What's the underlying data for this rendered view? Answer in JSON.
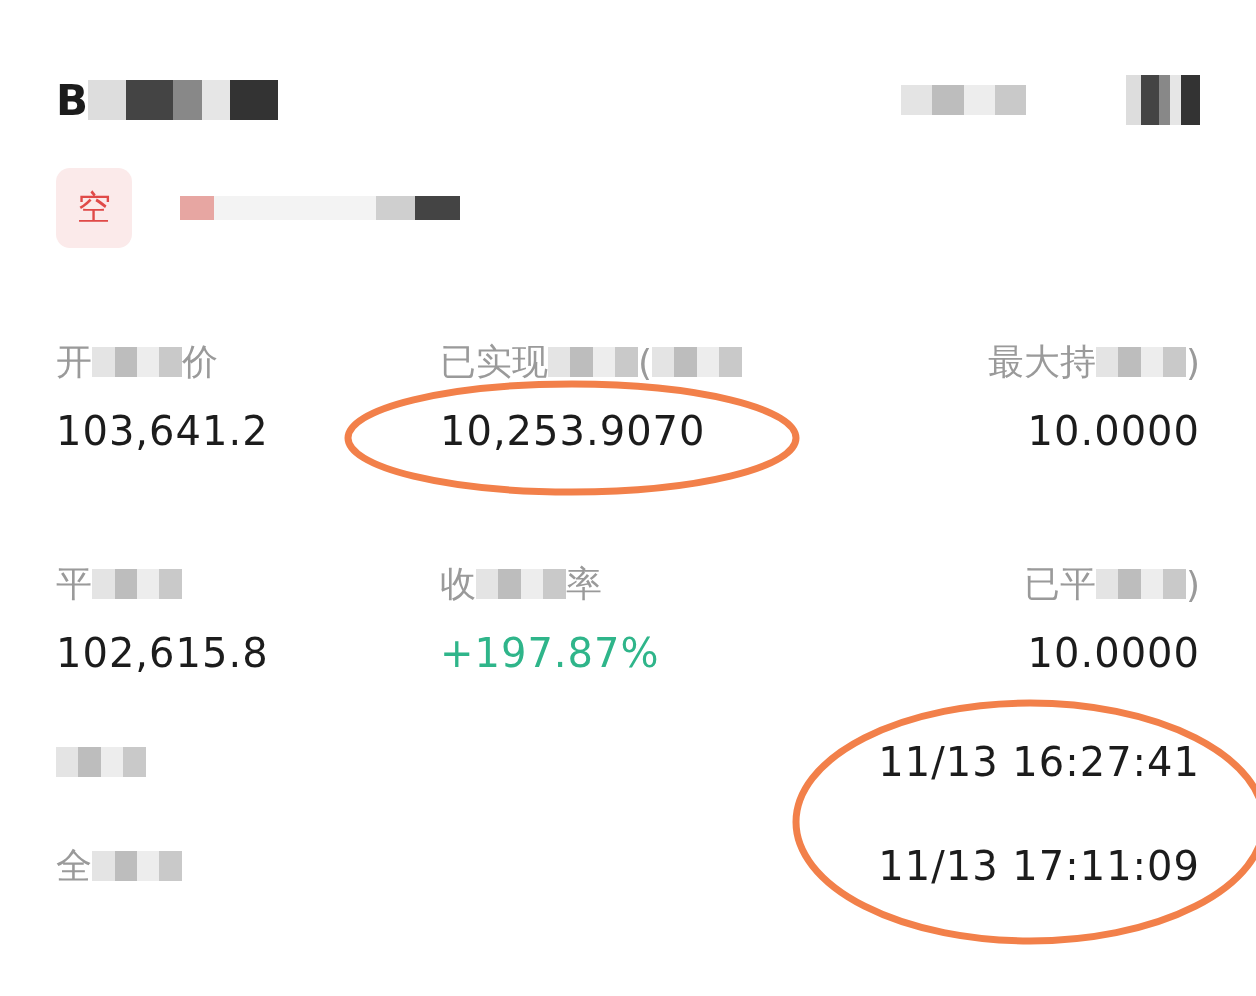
{
  "header": {
    "symbol": [
      {
        "kind": "text",
        "text": "B"
      },
      {
        "kind": "blur"
      }
    ],
    "right": [
      {
        "kind": "blur"
      }
    ]
  },
  "position": {
    "side": "空",
    "info": [
      {
        "kind": "blur"
      }
    ]
  },
  "stats": [
    {
      "label": [
        {
          "kind": "text",
          "text": "开"
        },
        {
          "kind": "blur"
        },
        {
          "kind": "text",
          "text": "价"
        }
      ],
      "value": "103,641.2",
      "color": "#1c1c1c"
    },
    {
      "label": [
        {
          "kind": "text",
          "text": "已实现"
        },
        {
          "kind": "blur"
        },
        {
          "kind": "text",
          "text": "("
        },
        {
          "kind": "blur"
        }
      ],
      "value": "10,253.9070",
      "color": "#1c1c1c"
    },
    {
      "label": [
        {
          "kind": "text",
          "text": "最大持"
        },
        {
          "kind": "blur"
        },
        {
          "kind": "text",
          "text": ")"
        }
      ],
      "value": "10.0000",
      "color": "#1c1c1c"
    },
    {
      "label": [
        {
          "kind": "text",
          "text": "平"
        },
        {
          "kind": "blur"
        }
      ],
      "value": "102,615.8",
      "color": "#1c1c1c"
    },
    {
      "label": [
        {
          "kind": "text",
          "text": "收"
        },
        {
          "kind": "blur"
        },
        {
          "kind": "text",
          "text": "率"
        }
      ],
      "value": "+197.87%",
      "color": "#2fb58a"
    },
    {
      "label": [
        {
          "kind": "text",
          "text": "已平"
        },
        {
          "kind": "blur"
        },
        {
          "kind": "text",
          "text": ")"
        }
      ],
      "value": "10.0000",
      "color": "#1c1c1c"
    }
  ],
  "times": [
    {
      "label": [
        {
          "kind": "blur"
        }
      ],
      "value": "11/13 16:27:41"
    },
    {
      "label": [
        {
          "kind": "text",
          "text": "全"
        },
        {
          "kind": "blur"
        }
      ],
      "value": "11/13 17:11:09"
    }
  ]
}
